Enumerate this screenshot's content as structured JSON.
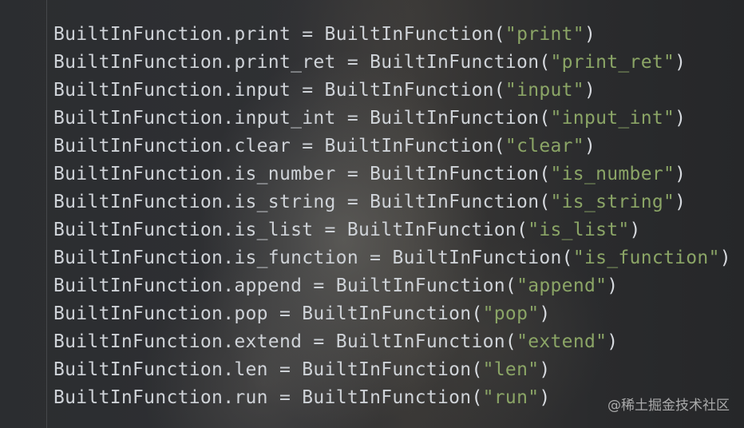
{
  "editor": {
    "lines": [
      {
        "target": "BuiltInFunction.print",
        "op": " = ",
        "callee": "BuiltInFunction",
        "arg": "\"print\""
      },
      {
        "target": "BuiltInFunction.print_ret",
        "op": " = ",
        "callee": "BuiltInFunction",
        "arg": "\"print_ret\""
      },
      {
        "target": "BuiltInFunction.input",
        "op": " = ",
        "callee": "BuiltInFunction",
        "arg": "\"input\""
      },
      {
        "target": "BuiltInFunction.input_int",
        "op": " = ",
        "callee": "BuiltInFunction",
        "arg": "\"input_int\""
      },
      {
        "target": "BuiltInFunction.clear",
        "op": " = ",
        "callee": "BuiltInFunction",
        "arg": "\"clear\""
      },
      {
        "target": "BuiltInFunction.is_number",
        "op": " = ",
        "callee": "BuiltInFunction",
        "arg": "\"is_number\""
      },
      {
        "target": "BuiltInFunction.is_string",
        "op": " = ",
        "callee": "BuiltInFunction",
        "arg": "\"is_string\""
      },
      {
        "target": "BuiltInFunction.is_list",
        "op": " = ",
        "callee": "BuiltInFunction",
        "arg": "\"is_list\""
      },
      {
        "target": "BuiltInFunction.is_function",
        "op": " = ",
        "callee": "BuiltInFunction",
        "arg": "\"is_function\""
      },
      {
        "target": "BuiltInFunction.append",
        "op": " = ",
        "callee": "BuiltInFunction",
        "arg": "\"append\""
      },
      {
        "target": "BuiltInFunction.pop",
        "op": " = ",
        "callee": "BuiltInFunction",
        "arg": "\"pop\""
      },
      {
        "target": "BuiltInFunction.extend",
        "op": " = ",
        "callee": "BuiltInFunction",
        "arg": "\"extend\""
      },
      {
        "target": "BuiltInFunction.len",
        "op": " = ",
        "callee": "BuiltInFunction",
        "arg": "\"len\""
      },
      {
        "target": "BuiltInFunction.run",
        "op": " = ",
        "callee": "BuiltInFunction",
        "arg": "\"run\""
      }
    ]
  },
  "watermark": "@稀土掘金技术社区",
  "colors": {
    "code_text": "#cfd3d8",
    "string_literal": "#8ba566",
    "background": "#2b2d30"
  }
}
